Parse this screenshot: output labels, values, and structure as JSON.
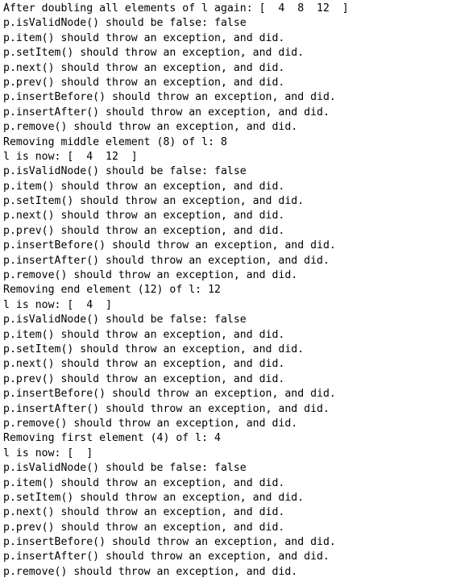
{
  "console": {
    "lines": [
      "After doubling all elements of l again: [  4  8  12  ]",
      "p.isValidNode() should be false: false",
      "p.item() should throw an exception, and did.",
      "p.setItem() should throw an exception, and did.",
      "p.next() should throw an exception, and did.",
      "p.prev() should throw an exception, and did.",
      "p.insertBefore() should throw an exception, and did.",
      "p.insertAfter() should throw an exception, and did.",
      "p.remove() should throw an exception, and did.",
      "Removing middle element (8) of l: 8",
      "l is now: [  4  12  ]",
      "p.isValidNode() should be false: false",
      "p.item() should throw an exception, and did.",
      "p.setItem() should throw an exception, and did.",
      "p.next() should throw an exception, and did.",
      "p.prev() should throw an exception, and did.",
      "p.insertBefore() should throw an exception, and did.",
      "p.insertAfter() should throw an exception, and did.",
      "p.remove() should throw an exception, and did.",
      "Removing end element (12) of l: 12",
      "l is now: [  4  ]",
      "p.isValidNode() should be false: false",
      "p.item() should throw an exception, and did.",
      "p.setItem() should throw an exception, and did.",
      "p.next() should throw an exception, and did.",
      "p.prev() should throw an exception, and did.",
      "p.insertBefore() should throw an exception, and did.",
      "p.insertAfter() should throw an exception, and did.",
      "p.remove() should throw an exception, and did.",
      "Removing first element (4) of l: 4",
      "l is now: [  ]",
      "p.isValidNode() should be false: false",
      "p.item() should throw an exception, and did.",
      "p.setItem() should throw an exception, and did.",
      "p.next() should throw an exception, and did.",
      "p.prev() should throw an exception, and did.",
      "p.insertBefore() should throw an exception, and did.",
      "p.insertAfter() should throw an exception, and did.",
      "p.remove() should throw an exception, and did."
    ]
  },
  "colors": {
    "background": "#ffffff",
    "text": "#000000"
  }
}
